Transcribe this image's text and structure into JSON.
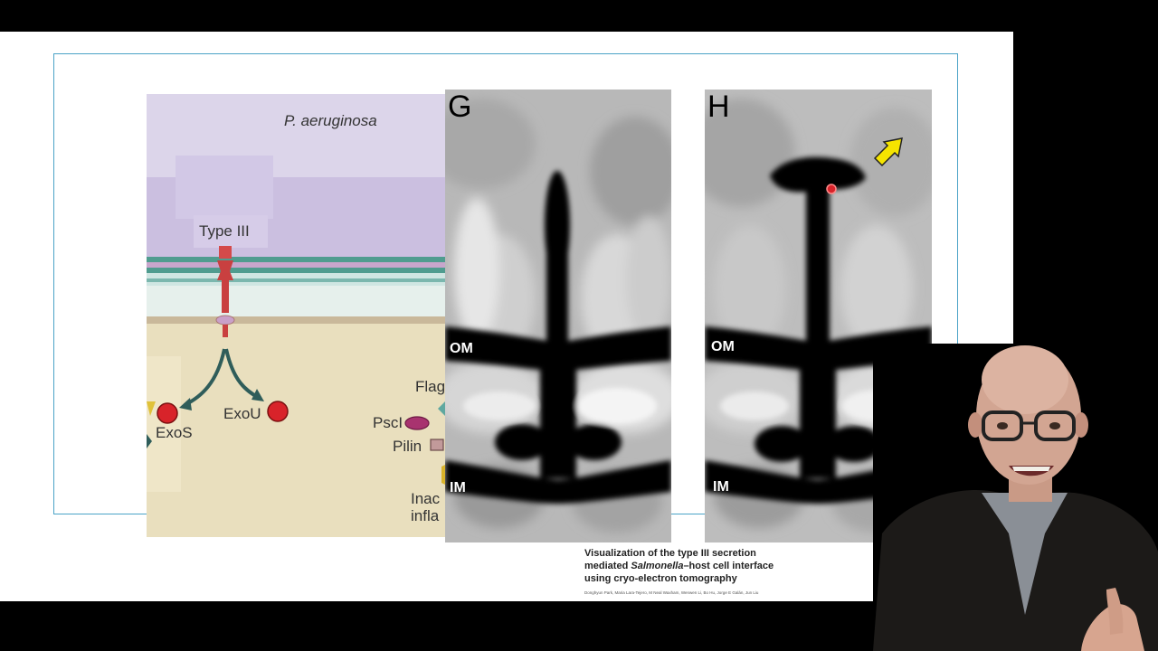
{
  "slide": {
    "diagram": {
      "organism": "P. aeruginosa",
      "system_label": "Type III",
      "effector_1": "ExoS",
      "effector_2": "ExoU",
      "side_label_1": "Flag",
      "side_label_2": "PscI",
      "side_label_3": "Pilin",
      "side_label_4": "Inac",
      "side_label_5": "infla"
    },
    "panel_g": {
      "letter": "G",
      "om_label": "OM",
      "im_label": "IM"
    },
    "panel_h": {
      "letter": "H",
      "om_label": "OM",
      "im_label": "IM"
    },
    "caption": {
      "title_part1": "Visualization of the type III secretion mediated ",
      "title_italic": "Salmonella",
      "title_part2": "–host cell interface using cryo-electron tomography",
      "authors": "Donghyun Park, Maria Lara-Tejero, M Neal Waxham, Wenwen Li, Bo Hu, Jorge E Galán, Jun Liu"
    }
  },
  "colors": {
    "background": "#000000",
    "slide": "#ffffff",
    "frame_border": "#4aa3c7",
    "effector_red": "#d8232a",
    "arrow_yellow": "#f5e400"
  }
}
